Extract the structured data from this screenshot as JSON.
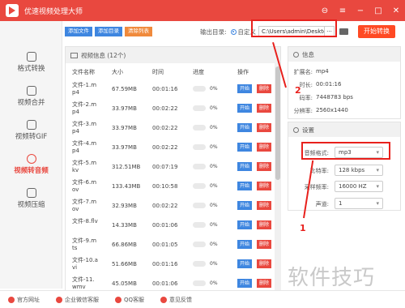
{
  "app": {
    "title": "优速视频处理大师"
  },
  "window_controls": [
    "⊖",
    "≡",
    "−",
    "□",
    "✕"
  ],
  "sidebar": {
    "items": [
      {
        "label": "格式转换"
      },
      {
        "label": "视频合并"
      },
      {
        "label": "视频转GIF"
      },
      {
        "label": "视频转音频"
      },
      {
        "label": "视频压缩"
      }
    ],
    "active_index": 3
  },
  "toolbar": {
    "add_file": "添加文件",
    "add_folder": "添加目录",
    "clear_list": "清除列表",
    "output_label": "输出目录:",
    "custom_label": "自定义",
    "output_path": "C:\\Users\\admin\\Deskto",
    "browse": "···",
    "start": "开始转换"
  },
  "video_panel": {
    "title": "视频信息 (12个)",
    "columns": [
      "文件名称",
      "大小",
      "时间",
      "进度",
      "操作"
    ],
    "open_label": "开始",
    "delete_label": "删除",
    "rows": [
      {
        "name": "文件-1.mp4",
        "size": "67.59MB",
        "time": "00:01:16",
        "progress": "0%"
      },
      {
        "name": "文件-2.mp4",
        "size": "33.97MB",
        "time": "00:02:22",
        "progress": "0%"
      },
      {
        "name": "文件-3.mp4",
        "size": "33.97MB",
        "time": "00:02:22",
        "progress": "0%"
      },
      {
        "name": "文件-4.mp4",
        "size": "33.97MB",
        "time": "00:02:22",
        "progress": "0%"
      },
      {
        "name": "文件-5.mkv",
        "size": "312.51MB",
        "time": "00:07:19",
        "progress": "0%"
      },
      {
        "name": "文件-6.mov",
        "size": "133.43MB",
        "time": "00:10:58",
        "progress": "0%"
      },
      {
        "name": "文件-7.mov",
        "size": "32.93MB",
        "time": "00:02:22",
        "progress": "0%"
      },
      {
        "name": "文件-8.flv",
        "size": "14.33MB",
        "time": "00:01:06",
        "progress": "0%"
      },
      {
        "name": "文件-9.mts",
        "size": "66.86MB",
        "time": "00:01:05",
        "progress": "0%"
      },
      {
        "name": "文件-10.avi",
        "size": "51.66MB",
        "time": "00:01:16",
        "progress": "0%"
      },
      {
        "name": "文件-11.wmv",
        "size": "45.05MB",
        "time": "00:01:06",
        "progress": "0%"
      }
    ]
  },
  "info_panel": {
    "title": "信息",
    "fields": [
      {
        "label": "扩展名:",
        "value": "mp4"
      },
      {
        "label": "时长:",
        "value": "00:01:16"
      },
      {
        "label": "码率:",
        "value": "7448783 bps"
      },
      {
        "label": "分辨率:",
        "value": "2560x1440"
      }
    ]
  },
  "settings_panel": {
    "title": "设置",
    "fields": [
      {
        "label": "音频格式:",
        "value": "mp3"
      },
      {
        "label": "比特率:",
        "value": "128 kbps"
      },
      {
        "label": "采样频率:",
        "value": "16000 HZ"
      },
      {
        "label": "声道:",
        "value": "1"
      }
    ]
  },
  "annotations": {
    "callout_1": "1",
    "callout_2": "2"
  },
  "watermark": "软件技巧",
  "footer": {
    "links": [
      "官方网址",
      "企业微信客服",
      "QQ客服",
      "意见反馈"
    ]
  },
  "colors": {
    "brand": "#e9483f",
    "button_blue": "#3e86e0",
    "clear_orange": "#f08a3c",
    "start_red": "#ff4a24",
    "annotation_red": "#e8201c"
  }
}
